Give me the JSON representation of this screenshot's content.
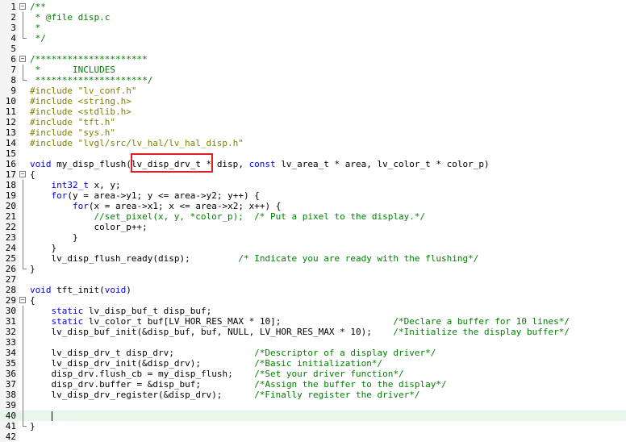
{
  "editor": {
    "file_name": "disp.c",
    "highlighted_token": "lv_disp_drv_t",
    "lines": [
      {
        "n": "1",
        "text": "/**",
        "cls": "cm"
      },
      {
        "n": "2",
        "text": " * @file disp.c",
        "cls": "cm"
      },
      {
        "n": "3",
        "text": " *",
        "cls": "cm"
      },
      {
        "n": "4",
        "text": " */",
        "cls": "cm"
      },
      {
        "n": "5",
        "text": "",
        "cls": ""
      },
      {
        "n": "6",
        "text": "/*********************",
        "cls": "cm"
      },
      {
        "n": "7",
        "text": " *      INCLUDES",
        "cls": "cm"
      },
      {
        "n": "8",
        "text": " *********************/",
        "cls": "cm"
      },
      {
        "n": "9",
        "text": "#include \"lv_conf.h\"",
        "cls": "pp"
      },
      {
        "n": "10",
        "text": "#include <string.h>",
        "cls": "pp"
      },
      {
        "n": "11",
        "text": "#include <stdlib.h>",
        "cls": "pp"
      },
      {
        "n": "12",
        "text": "#include \"tft.h\"",
        "cls": "pp"
      },
      {
        "n": "13",
        "text": "#include \"sys.h\"",
        "cls": "pp"
      },
      {
        "n": "14",
        "text": "#include \"lvgl/src/lv_hal/lv_hal_disp.h\"",
        "cls": "pp"
      },
      {
        "n": "15",
        "text": "",
        "cls": ""
      },
      {
        "n": "16",
        "text": "void my_disp_flush(lv_disp_drv_t * disp, const lv_area_t * area, lv_color_t * color_p)",
        "cls": ""
      },
      {
        "n": "17",
        "text": "{",
        "cls": ""
      },
      {
        "n": "18",
        "text": "    int32_t x, y;",
        "cls": ""
      },
      {
        "n": "19",
        "text": "    for(y = area->y1; y <= area->y2; y++) {",
        "cls": ""
      },
      {
        "n": "20",
        "text": "        for(x = area->x1; x <= area->x2; x++) {",
        "cls": ""
      },
      {
        "n": "21",
        "text": "            //set_pixel(x, y, *color_p);  /* Put a pixel to the display.*/",
        "cls": "cm"
      },
      {
        "n": "22",
        "text": "            color_p++;",
        "cls": ""
      },
      {
        "n": "23",
        "text": "        }",
        "cls": ""
      },
      {
        "n": "24",
        "text": "    }",
        "cls": ""
      },
      {
        "n": "25",
        "text": "    lv_disp_flush_ready(disp);         /* Indicate you are ready with the flushing*/",
        "cls": ""
      },
      {
        "n": "26",
        "text": "}",
        "cls": ""
      },
      {
        "n": "27",
        "text": "",
        "cls": ""
      },
      {
        "n": "28",
        "text": "void tft_init(void)",
        "cls": ""
      },
      {
        "n": "29",
        "text": "{",
        "cls": ""
      },
      {
        "n": "30",
        "text": "    static lv_disp_buf_t disp_buf;",
        "cls": ""
      },
      {
        "n": "31",
        "text": "    static lv_color_t buf[LV_HOR_RES_MAX * 10];                     /*Declare a buffer for 10 lines*/",
        "cls": ""
      },
      {
        "n": "32",
        "text": "    lv_disp_buf_init(&disp_buf, buf, NULL, LV_HOR_RES_MAX * 10);    /*Initialize the display buffer*/",
        "cls": ""
      },
      {
        "n": "33",
        "text": "",
        "cls": ""
      },
      {
        "n": "34",
        "text": "    lv_disp_drv_t disp_drv;               /*Descriptor of a display driver*/",
        "cls": ""
      },
      {
        "n": "35",
        "text": "    lv_disp_drv_init(&disp_drv);          /*Basic initialization*/",
        "cls": ""
      },
      {
        "n": "36",
        "text": "    disp_drv.flush_cb = my_disp_flush;    /*Set your driver function*/",
        "cls": ""
      },
      {
        "n": "37",
        "text": "    disp_drv.buffer = &disp_buf;          /*Assign the buffer to the display*/",
        "cls": ""
      },
      {
        "n": "38",
        "text": "    lv_disp_drv_register(&disp_drv);      /*Finally register the driver*/",
        "cls": ""
      },
      {
        "n": "39",
        "text": "",
        "cls": ""
      },
      {
        "n": "40",
        "text": "",
        "cls": "",
        "current": true
      },
      {
        "n": "41",
        "text": "}",
        "cls": ""
      },
      {
        "n": "42",
        "text": "",
        "cls": ""
      }
    ]
  },
  "colors": {
    "keyword": "#0000ff",
    "comment": "#008000",
    "preprocessor": "#808000",
    "current_line": "#e8f6ea",
    "highlight_box": "#e02020"
  }
}
